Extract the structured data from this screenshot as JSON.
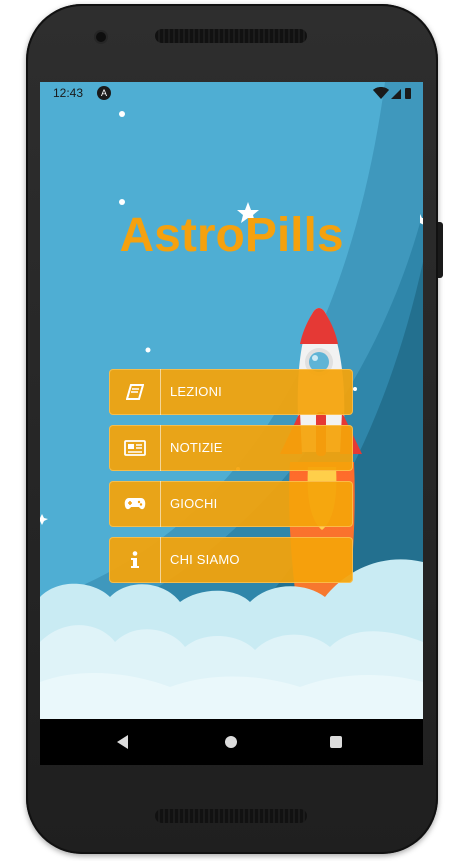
{
  "statusbar": {
    "time": "12:43",
    "app_icon": "A"
  },
  "app": {
    "title": "AstroPills"
  },
  "menu": [
    {
      "label": "LEZIONI",
      "icon": "book-icon"
    },
    {
      "label": "NOTIZIE",
      "icon": "newspaper-icon"
    },
    {
      "label": "GIOCHI",
      "icon": "gamepad-icon"
    },
    {
      "label": "CHI SIAMO",
      "icon": "info-icon"
    }
  ],
  "colors": {
    "accent": "#f5a10e",
    "sky": "#4faed3",
    "sky_dark": "#2a7f9f",
    "cloud": "#dff3f8"
  }
}
